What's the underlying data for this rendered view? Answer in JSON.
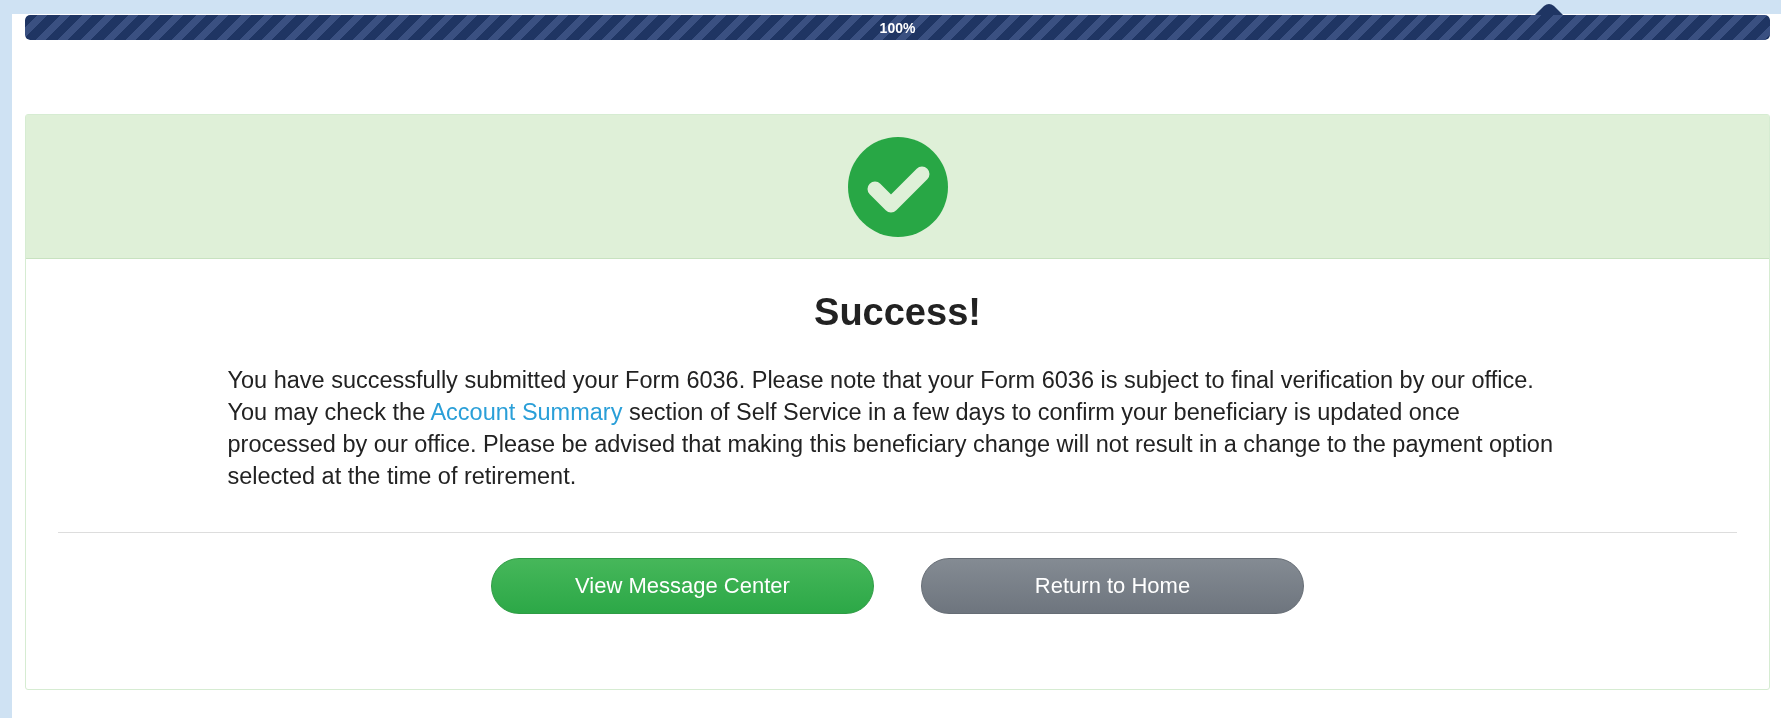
{
  "progress": {
    "level": 1,
    "label": "100%"
  },
  "message": {
    "title": "Success!",
    "text_before": "You have successfully submitted your Form 6036. Please note that your Form 6036 is subject to final verification by our office. You may check the ",
    "link": "Account Summary",
    "text_after": " section of Self Service in a few days to confirm your beneficiary is updated once processed by our office. Please be advised that making this beneficiary change will not result in a change to the payment option selected at the time of retirement."
  },
  "buttons": [
    {
      "label": "View Message Center",
      "kind": "primary"
    },
    {
      "label": "Return to Home",
      "kind": "secondary"
    }
  ]
}
